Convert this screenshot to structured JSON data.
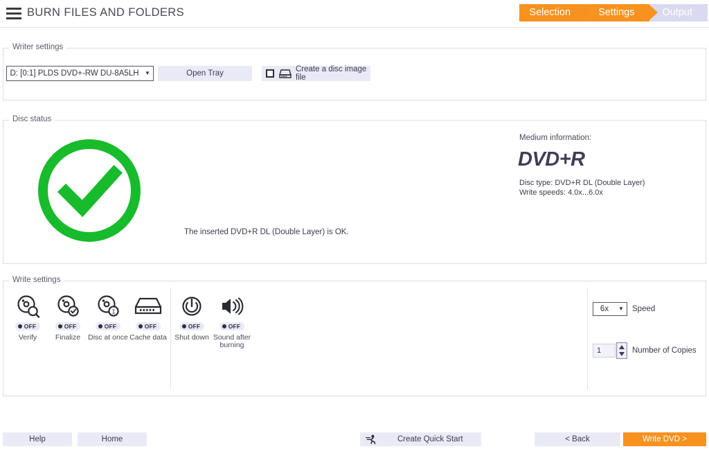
{
  "header": {
    "title": "BURN FILES AND FOLDERS",
    "menu_icon": "hamburger-icon",
    "steps": [
      {
        "label": "Selection",
        "state": "active"
      },
      {
        "label": "Settings",
        "state": "active"
      },
      {
        "label": "Output",
        "state": "inactive"
      }
    ]
  },
  "colors": {
    "accent_orange": "#F7921E",
    "inactive_step": "#d9d9f0",
    "button_bg": "#eaeaf7",
    "status_green": "#18bb2b",
    "text": "#3b3b4f"
  },
  "writer_settings": {
    "group_label": "Writer settings",
    "drive_select": {
      "value": "D: [0:1] PLDS   DVD+-RW DU-8A5LH",
      "arrow": "chevron-down-icon"
    },
    "open_tray_label": "Open Tray",
    "disc_image": {
      "label": "Create a disc image file",
      "checked": false,
      "icon": "disc-drive-icon"
    }
  },
  "disc_status": {
    "group_label": "Disc status",
    "status_icon": "check-circle-icon",
    "status_message": "The inserted DVD+R DL (Double Layer) is OK.",
    "medium_information_label": "Medium information:",
    "medium_type": "DVD+R",
    "disc_type_line": "Disc type: DVD+R DL (Double Layer)",
    "write_speeds_line": "Write speeds: 4.0x...6.0x"
  },
  "write_settings": {
    "group_label": "Write settings",
    "options": [
      {
        "label": "Verify",
        "state": "OFF",
        "icon": "disc-magnifier-icon"
      },
      {
        "label": "Finalize",
        "state": "OFF",
        "icon": "disc-check-icon"
      },
      {
        "label": "Disc at once",
        "state": "OFF",
        "icon": "disc-one-icon"
      },
      {
        "label": "Cache data",
        "state": "OFF",
        "icon": "drive-cache-icon"
      },
      {
        "label": "Shut down",
        "state": "OFF",
        "icon": "power-icon"
      },
      {
        "label": "Sound after burning",
        "state": "OFF",
        "icon": "speaker-icon"
      }
    ],
    "speed": {
      "value": "6x",
      "label": "Speed"
    },
    "copies": {
      "value": "1",
      "label": "Number of Copies",
      "spinner_icon": "spinner-up-down-icon"
    }
  },
  "footer": {
    "help_label": "Help",
    "home_label": "Home",
    "quick_start_label": "Create Quick Start",
    "quick_start_icon": "running-person-icon",
    "back_label": "< Back",
    "write_label": "Write DVD >"
  }
}
